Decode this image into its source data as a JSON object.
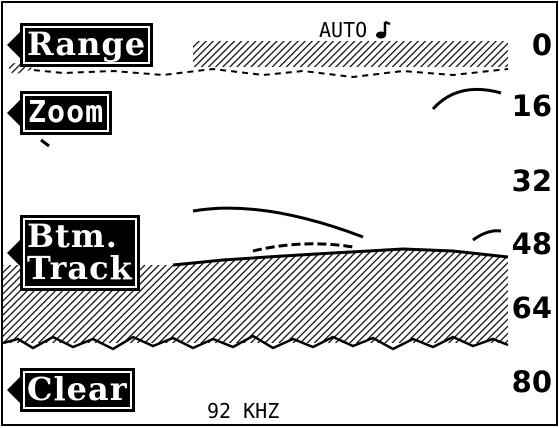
{
  "softkeys": {
    "range": "Range",
    "zoom": "Zoom",
    "btm_track": "Btm.\nTrack",
    "clear": "Clear"
  },
  "status": {
    "mode": "AUTO",
    "frequency": "92 KHZ"
  },
  "depth_scale": [
    "0",
    "16",
    "32",
    "48",
    "64",
    "80"
  ],
  "icons": {
    "softkey_arrow": "left-triangle",
    "alarm": "music-note-icon"
  },
  "colors": {
    "background": "#ffffff",
    "foreground": "#000000"
  }
}
